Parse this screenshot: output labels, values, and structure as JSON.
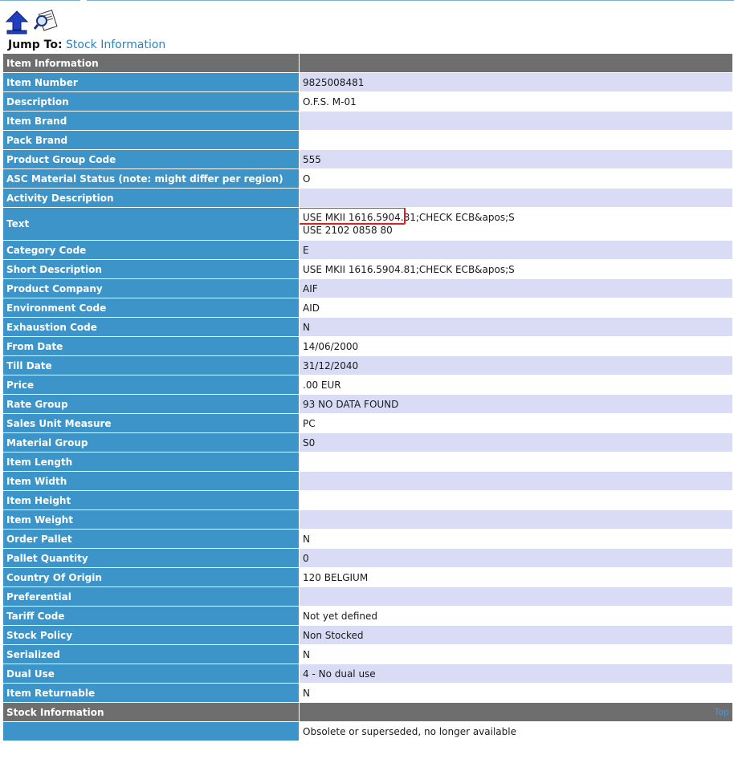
{
  "nav": {
    "jump_label": "Jump To:",
    "jump_link": "Stock Information"
  },
  "icons": {
    "up": "up-arrow-icon",
    "search": "magnifier-document-icon"
  },
  "sections": {
    "item_info": "Item Information",
    "stock_info": "Stock Information",
    "top_link": "Top"
  },
  "rows": [
    {
      "label": "Item Number",
      "value": "9825008481"
    },
    {
      "label": "Description",
      "value": "O.F.S. M-01"
    },
    {
      "label": "Item Brand",
      "value": ""
    },
    {
      "label": "Pack Brand",
      "value": ""
    },
    {
      "label": "Product Group Code",
      "value": "555"
    },
    {
      "label": "ASC Material Status (note: might differ per region)",
      "value": "O"
    },
    {
      "label": "Activity Description",
      "value": ""
    },
    {
      "label": "Text",
      "value": "USE MKII 1616.5904.81;CHECK ECB&apos;S",
      "value2": "USE 2102 0858 80"
    },
    {
      "label": "Category Code",
      "value": "E"
    },
    {
      "label": "Short Description",
      "value": "USE MKII 1616.5904.81;CHECK ECB&apos;S"
    },
    {
      "label": "Product Company",
      "value": "AIF"
    },
    {
      "label": "Environment Code",
      "value": "AID"
    },
    {
      "label": "Exhaustion Code",
      "value": "N"
    },
    {
      "label": "From Date",
      "value": "14/06/2000"
    },
    {
      "label": "Till Date",
      "value": "31/12/2040"
    },
    {
      "label": "Price",
      "value": ".00 EUR"
    },
    {
      "label": "Rate Group",
      "value": "93 NO DATA FOUND"
    },
    {
      "label": "Sales Unit Measure",
      "value": "PC"
    },
    {
      "label": "Material Group",
      "value": "S0"
    },
    {
      "label": "Item Length",
      "value": ""
    },
    {
      "label": "Item Width",
      "value": ""
    },
    {
      "label": "Item Height",
      "value": ""
    },
    {
      "label": "Item Weight",
      "value": ""
    },
    {
      "label": "Order Pallet",
      "value": "N"
    },
    {
      "label": "Pallet Quantity",
      "value": "0"
    },
    {
      "label": "Country Of Origin",
      "value": "120 BELGIUM"
    },
    {
      "label": "Preferential",
      "value": ""
    },
    {
      "label": "Tariff Code",
      "value": "Not yet defined"
    },
    {
      "label": "Stock Policy",
      "value": "Non Stocked"
    },
    {
      "label": "Serialized",
      "value": "N"
    },
    {
      "label": "Dual Use",
      "value": "4 - No dual use"
    },
    {
      "label": "Item Returnable",
      "value": "N"
    }
  ],
  "stock_rows": [
    {
      "label": "",
      "value": "Obsolete or superseded, no longer available"
    }
  ],
  "colors": {
    "label_bg": "#3d94c9",
    "stripe": "#dadcf6",
    "header_bg": "#6e6e6e",
    "highlight": "#e02020"
  }
}
